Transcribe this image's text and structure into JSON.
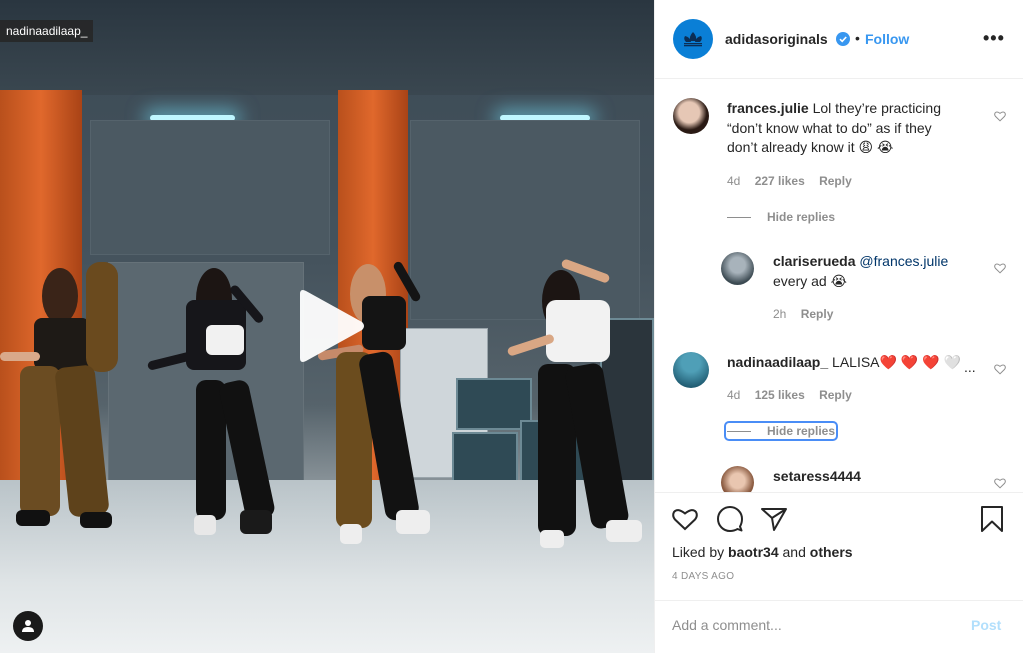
{
  "video": {
    "owner_tag": "nadinaadilaap_",
    "play_icon": "play-icon",
    "user_tags_icon": "user-icon"
  },
  "post": {
    "author": "adidasoriginals",
    "verified_icon": "verified-badge-icon",
    "separator": "•",
    "follow_label": "Follow",
    "more_label": "•••"
  },
  "comments": [
    {
      "username": "frances.julie",
      "text": "Lol they’re practicing",
      "text_line2": "“don’t know what to do” as if they",
      "text_line3": "don’t already know it 😩 😭",
      "age": "4d",
      "likes": "227 likes",
      "reply_label": "Reply",
      "hide_replies": "Hide replies",
      "replies": [
        {
          "username": "clariserueda",
          "mention": "@frances.julie",
          "text": "every ad 😭",
          "age": "2h",
          "reply_label": "Reply"
        }
      ]
    },
    {
      "username": "nadinaadilaap_",
      "text": "LALISA❤️ ❤️ ❤️ 🤍",
      "ellipsis": "...",
      "age": "4d",
      "likes": "125 likes",
      "reply_label": "Reply",
      "hide_replies": "Hide replies",
      "replies": [
        {
          "username": "setaress4444"
        }
      ]
    }
  ],
  "actions": {
    "like_icon": "heart-icon",
    "comment_icon": "comment-icon",
    "share_icon": "share-icon",
    "save_icon": "bookmark-icon",
    "liked_by_prefix": "Liked by",
    "liked_by_user": "baotr34",
    "liked_by_and": "and",
    "liked_by_others": "others",
    "date": "4 DAYS AGO"
  },
  "add_comment": {
    "placeholder": "Add a comment...",
    "post_label": "Post"
  },
  "colors": {
    "link_blue": "#3897f0",
    "post_disabled": "#b2dffc",
    "muted": "#8e8e8e",
    "like_red": "#ed4956"
  }
}
